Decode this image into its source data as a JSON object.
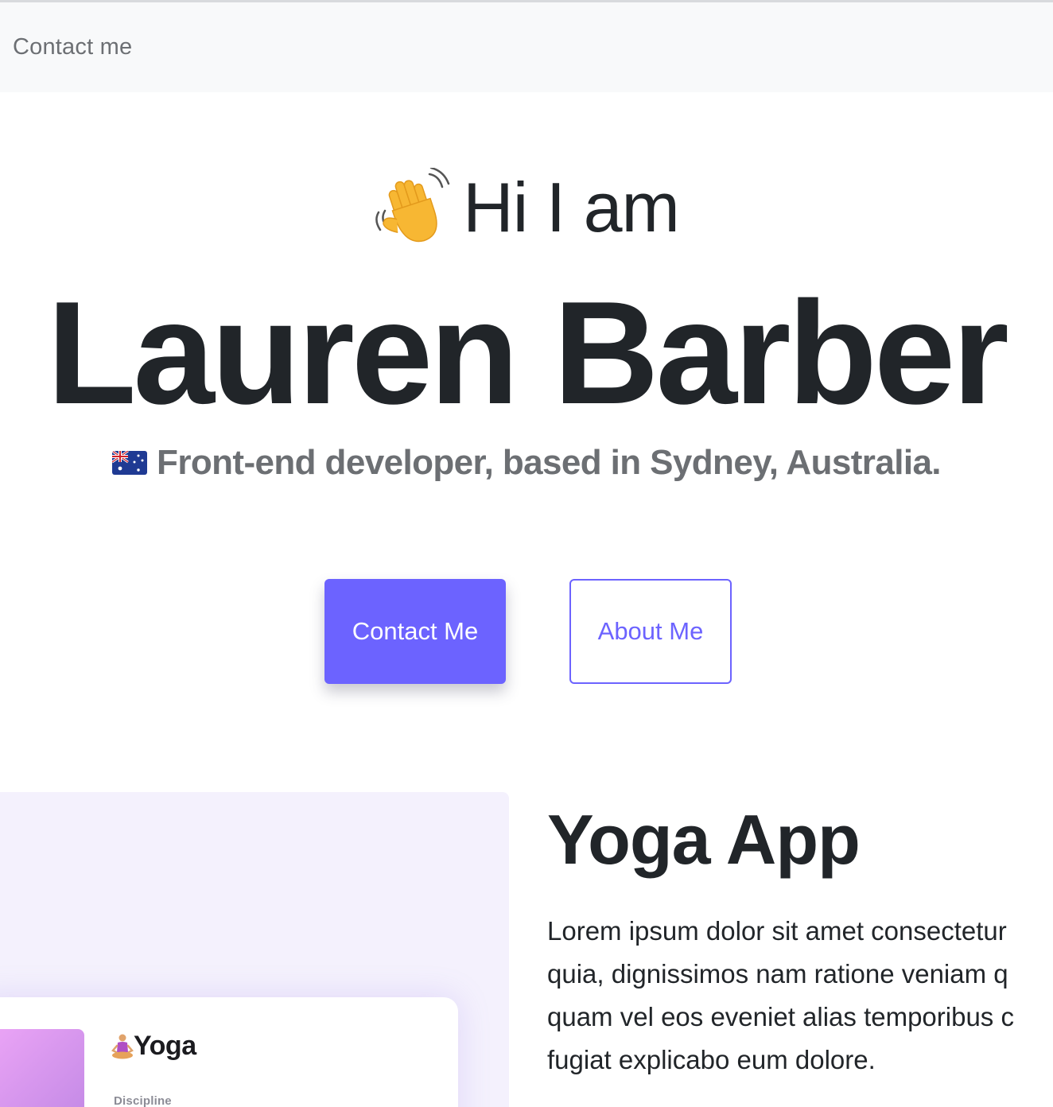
{
  "nav": {
    "contact_link": "Contact me"
  },
  "hero": {
    "greeting_icon": "waving-hand-icon",
    "greeting": "Hi I am",
    "name": "Lauren Barber",
    "subtitle_icon": "australia-flag-icon",
    "subtitle": "Front-end developer, based in Sydney, Australia."
  },
  "buttons": {
    "contact": "Contact Me",
    "about": "About Me"
  },
  "project": {
    "title": "Yoga App",
    "description_lines": [
      "Lorem ipsum dolor sit amet consectetur",
      "quia, dignissimos nam ratione veniam q",
      "quam vel eos eveniet alias temporibus c",
      "fugiat explicabo eum dolore."
    ],
    "preview": {
      "icon": "meditating-person-icon",
      "title": "Yoga",
      "label": "Discipline"
    }
  },
  "colors": {
    "accent": "#6c63ff",
    "nav_bg": "#f8f9fa",
    "text": "#212529",
    "muted": "#6c6f73",
    "preview_bg": "#f4f1fd"
  }
}
